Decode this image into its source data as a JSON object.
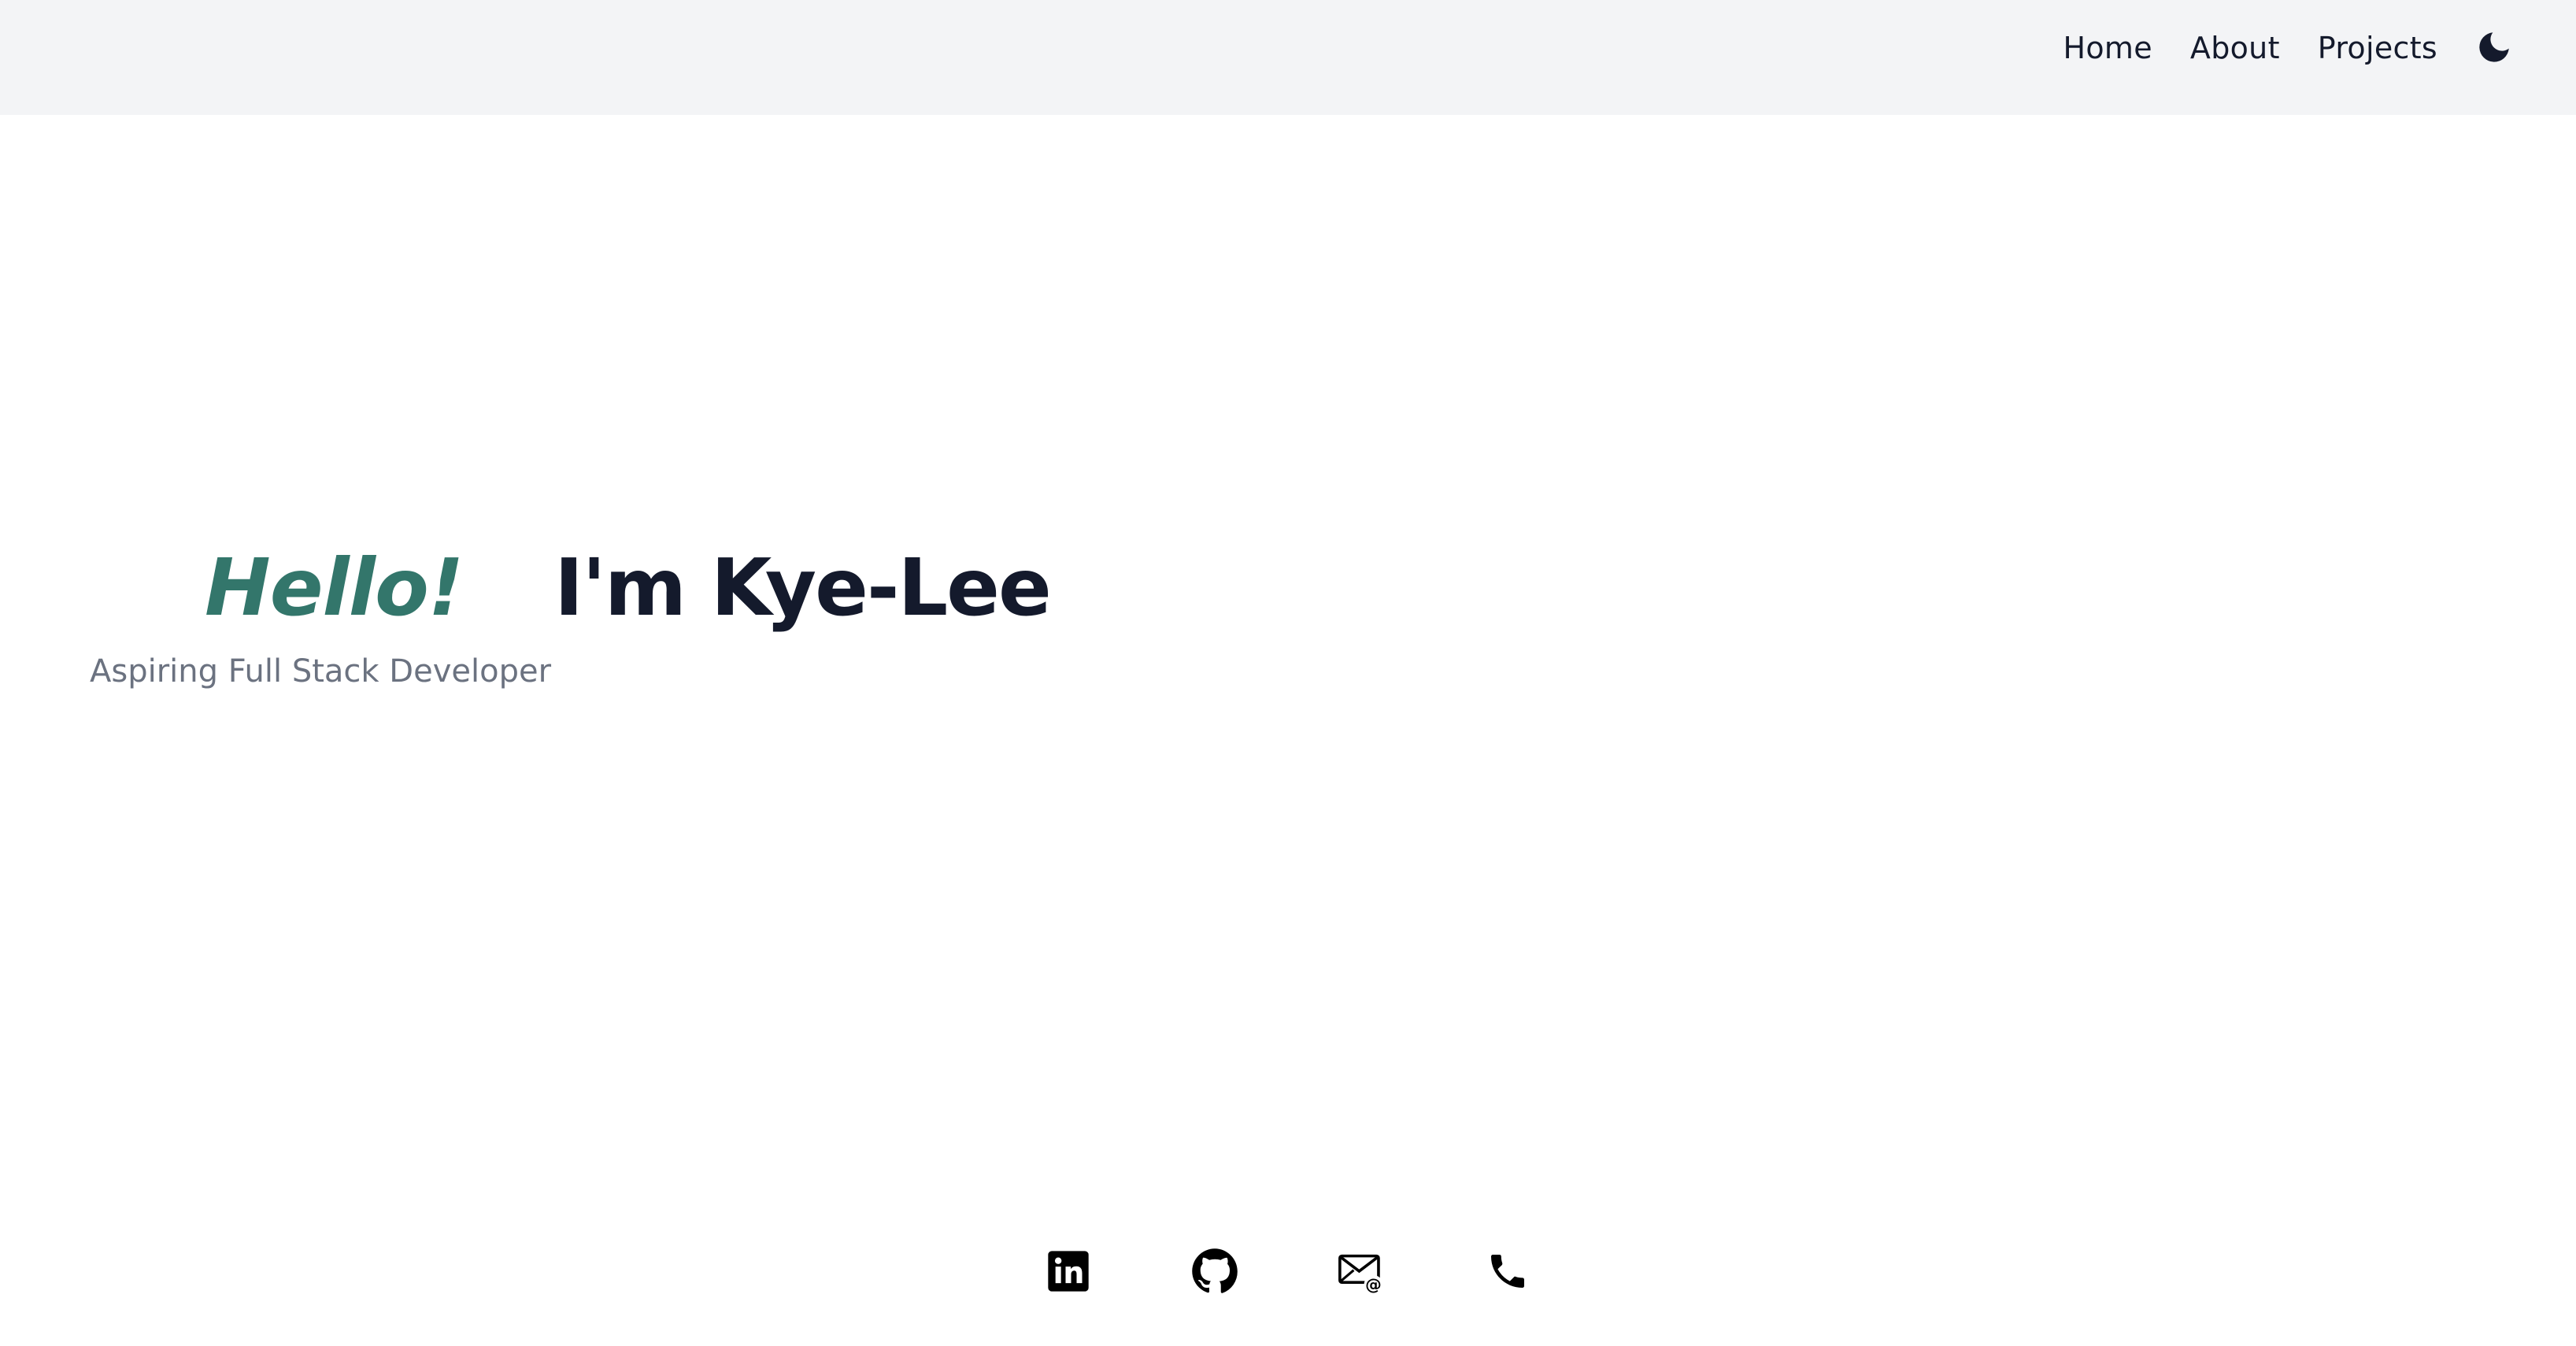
{
  "nav": {
    "items": [
      {
        "label": "Home"
      },
      {
        "label": "About"
      },
      {
        "label": "Projects"
      }
    ],
    "theme_icon": "moon-icon"
  },
  "hero": {
    "greeting": "Hello!",
    "intro": "I'm Kye-Lee",
    "subtitle": "Aspiring Full Stack Developer"
  },
  "socials": [
    {
      "icon": "linkedin-icon"
    },
    {
      "icon": "github-icon"
    },
    {
      "icon": "email-icon"
    },
    {
      "icon": "phone-icon"
    }
  ],
  "colors": {
    "accent": "#33766b",
    "text": "#141a2c",
    "muted": "#6b7280",
    "navbar_bg": "#f3f4f6"
  }
}
